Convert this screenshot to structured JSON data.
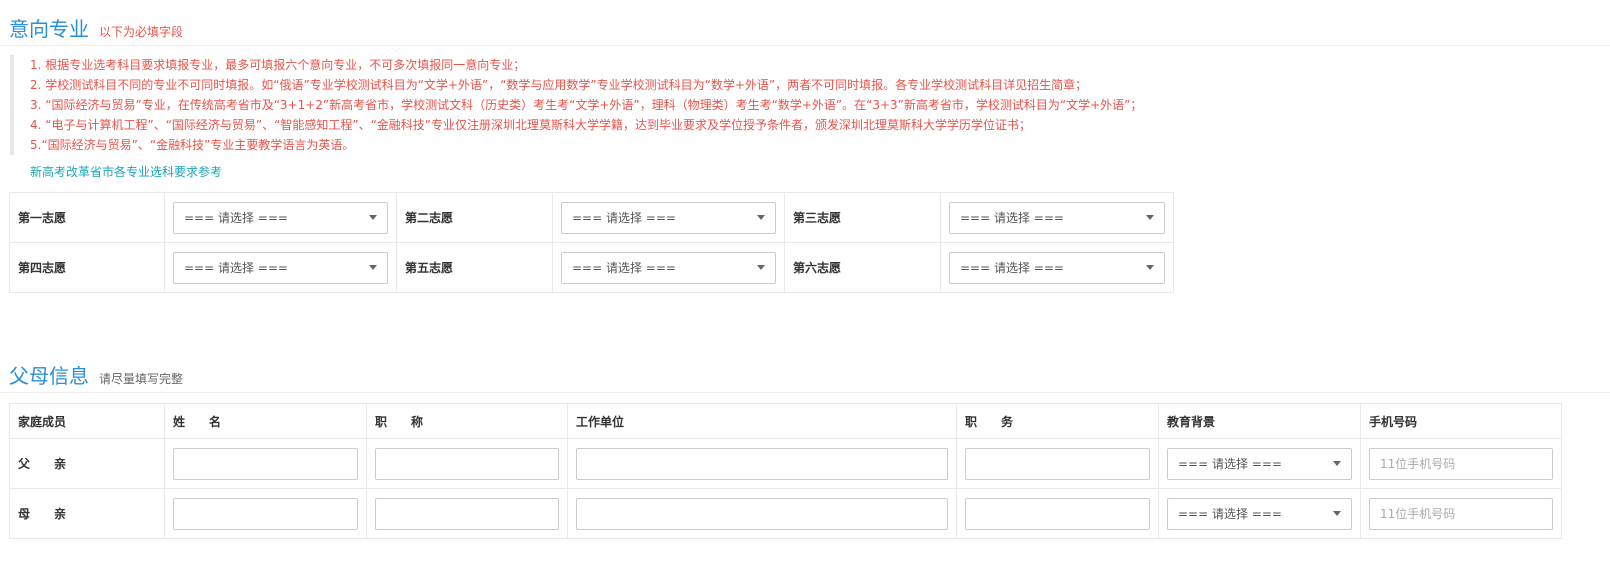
{
  "major": {
    "title": "意向专业",
    "subtitle": "以下为必填字段",
    "notes": [
      "1. 根据专业选考科目要求填报专业，最多可填报六个意向专业，不可多次填报同一意向专业；",
      "2. 学校测试科目不同的专业不可同时填报。如“俄语”专业学校测试科目为“文学+外语”，“数学与应用数学”专业学校测试科目为“数学+外语”，两者不可同时填报。各专业学校测试科目详见招生简章；",
      "3. “国际经济与贸易”专业，在传统高考省市及“3+1+2”新高考省市，学校测试文科（历史类）考生考“文学+外语”，理科（物理类）考生考“数学+外语”。在“3+3”新高考省市，学校测试科目为“文学+外语”；",
      "4. “电子与计算机工程”、“国际经济与贸易”、“智能感知工程”、“金融科技”专业仅注册深圳北理莫斯科大学学籍，达到毕业要求及学位授予条件者，颁发深圳北理莫斯科大学学历学位证书；",
      "5.“国际经济与贸易”、“金融科技”专业主要教学语言为英语。"
    ],
    "reference_link": "新高考改革省市各专业选科要求参考",
    "choices": [
      {
        "label": "第一志愿",
        "value": "=== 请选择 ==="
      },
      {
        "label": "第二志愿",
        "value": "=== 请选择 ==="
      },
      {
        "label": "第三志愿",
        "value": "=== 请选择 ==="
      },
      {
        "label": "第四志愿",
        "value": "=== 请选择 ==="
      },
      {
        "label": "第五志愿",
        "value": "=== 请选择 ==="
      },
      {
        "label": "第六志愿",
        "value": "=== 请选择 ==="
      }
    ]
  },
  "parents": {
    "title": "父母信息",
    "subtitle": "请尽量填写完整",
    "headers": [
      "家庭成员",
      "姓　　名",
      "职　　称",
      "工作单位",
      "职　　务",
      "教育背景",
      "手机号码"
    ],
    "rows": [
      {
        "member": "父　　亲",
        "education": "=== 请选择 ===",
        "phone_placeholder": "11位手机号码"
      },
      {
        "member": "母　　亲",
        "education": "=== 请选择 ===",
        "phone_placeholder": "11位手机号码"
      }
    ]
  }
}
